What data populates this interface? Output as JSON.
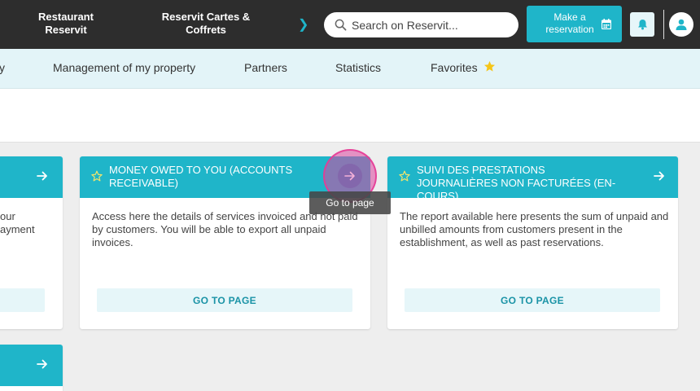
{
  "topbar": {
    "products": [
      "Restaurant Reservit",
      "Reservit Cartes & Coffrets"
    ],
    "search_placeholder": "Search on Reservit...",
    "reserve_label": "Make a reservation"
  },
  "subnav": {
    "items": [
      "y",
      "Management of my property",
      "Partners",
      "Statistics",
      "Favorites"
    ]
  },
  "cards": [
    {
      "title": "",
      "body": "our\nayment",
      "button": ""
    },
    {
      "title": "Money owed to you (accounts receivable)",
      "body": "Access here the details of services invoiced and not paid by customers. You will be able to export all unpaid invoices.",
      "button": "GO TO PAGE"
    },
    {
      "title": "Suivi des prestations journalières non facturées (en-cours)",
      "body": "The report available here presents the sum of unpaid and unbilled amounts from customers present in the establishment, as well as past reservations.",
      "button": "GO TO PAGE"
    }
  ],
  "tooltip": "Go to page",
  "colors": {
    "topbar": "#2d2d2d",
    "accent": "#1fb5c9",
    "subnav": "#e3f4f8",
    "star": "#f5c518"
  }
}
